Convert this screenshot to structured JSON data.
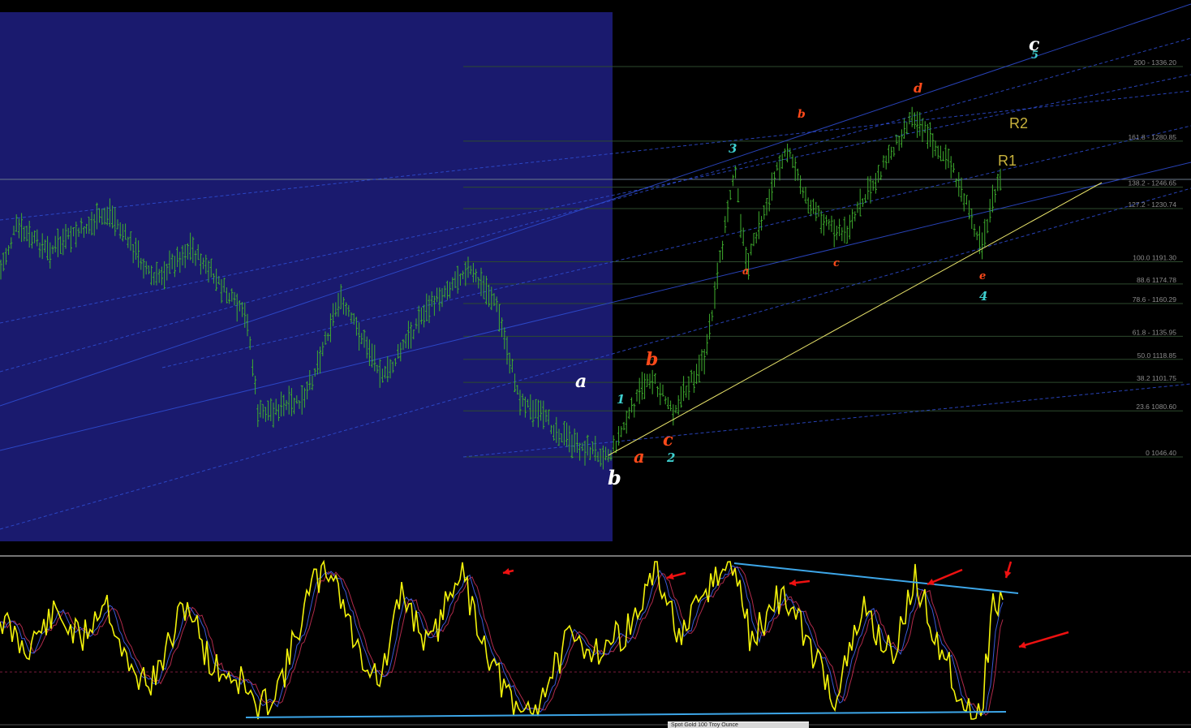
{
  "chart_data": [
    {
      "type": "ohlc",
      "price_axis_visible": false,
      "colors": {
        "background": "#000000",
        "highlight_region": "#1a1a6e",
        "bars": "#3fae2e",
        "fib_lines": "#2e4a2e",
        "channel_lines": "#2f4ed6",
        "trendline": "#e8e36a",
        "fib_text": "#8c8c8c"
      },
      "fibonacci_levels": [
        {
          "label": "200 - 1336.20",
          "price": 1336.2
        },
        {
          "label": "161.8 - 1280.85",
          "price": 1280.85
        },
        {
          "label": "138.2 - 1246.65",
          "price": 1246.65
        },
        {
          "label": "127.2 - 1230.74",
          "price": 1230.74
        },
        {
          "label": "100.0 1191.30",
          "price": 1191.3
        },
        {
          "label": "88.6 1174.78",
          "price": 1174.78
        },
        {
          "label": "78.6 - 1160.29",
          "price": 1160.29
        },
        {
          "label": "61.8 - 1135.95",
          "price": 1135.95
        },
        {
          "label": "50.0 1118.85",
          "price": 1118.85
        },
        {
          "label": "38.2 1101.75",
          "price": 1101.75
        },
        {
          "label": "23.6 1080.60",
          "price": 1080.6
        },
        {
          "label": "0 1046.40",
          "price": 1046.4
        }
      ],
      "wave_labels": [
        {
          "text": "a",
          "color": "#ffffff",
          "size": "large"
        },
        {
          "text": "b",
          "color": "#ffffff",
          "size": "large"
        },
        {
          "text": "c",
          "color": "#ffffff",
          "size": "large"
        },
        {
          "text": "1",
          "color": "#3ecfcf",
          "size": "medium"
        },
        {
          "text": "2",
          "color": "#3ecfcf",
          "size": "medium"
        },
        {
          "text": "3",
          "color": "#3ecfcf",
          "size": "medium"
        },
        {
          "text": "4",
          "color": "#3ecfcf",
          "size": "medium"
        },
        {
          "text": "5",
          "color": "#3ecfcf",
          "size": "medium"
        },
        {
          "text": "a",
          "color": "#ff4a1a",
          "size": "large"
        },
        {
          "text": "b",
          "color": "#ff4a1a",
          "size": "large"
        },
        {
          "text": "c",
          "color": "#ff4a1a",
          "size": "large"
        },
        {
          "text": "a",
          "color": "#ff4a1a",
          "size": "small"
        },
        {
          "text": "b",
          "color": "#ff4a1a",
          "size": "small"
        },
        {
          "text": "c",
          "color": "#ff4a1a",
          "size": "small"
        },
        {
          "text": "d",
          "color": "#ff4a1a",
          "size": "small"
        },
        {
          "text": "e",
          "color": "#ff4a1a",
          "size": "small"
        }
      ],
      "resistance_labels": [
        "R1",
        "R2"
      ]
    },
    {
      "type": "line",
      "colors": {
        "main_line": "#f2f20a",
        "signal_1": "#3a5ad8",
        "signal_2": "#b02a4a",
        "zero_line": "#7a1a3a",
        "trendlines": "#3da6e8",
        "arrows": "#ee1111"
      }
    }
  ],
  "status_tab": {
    "text": "Spot Gold 100 Troy Ounce"
  }
}
